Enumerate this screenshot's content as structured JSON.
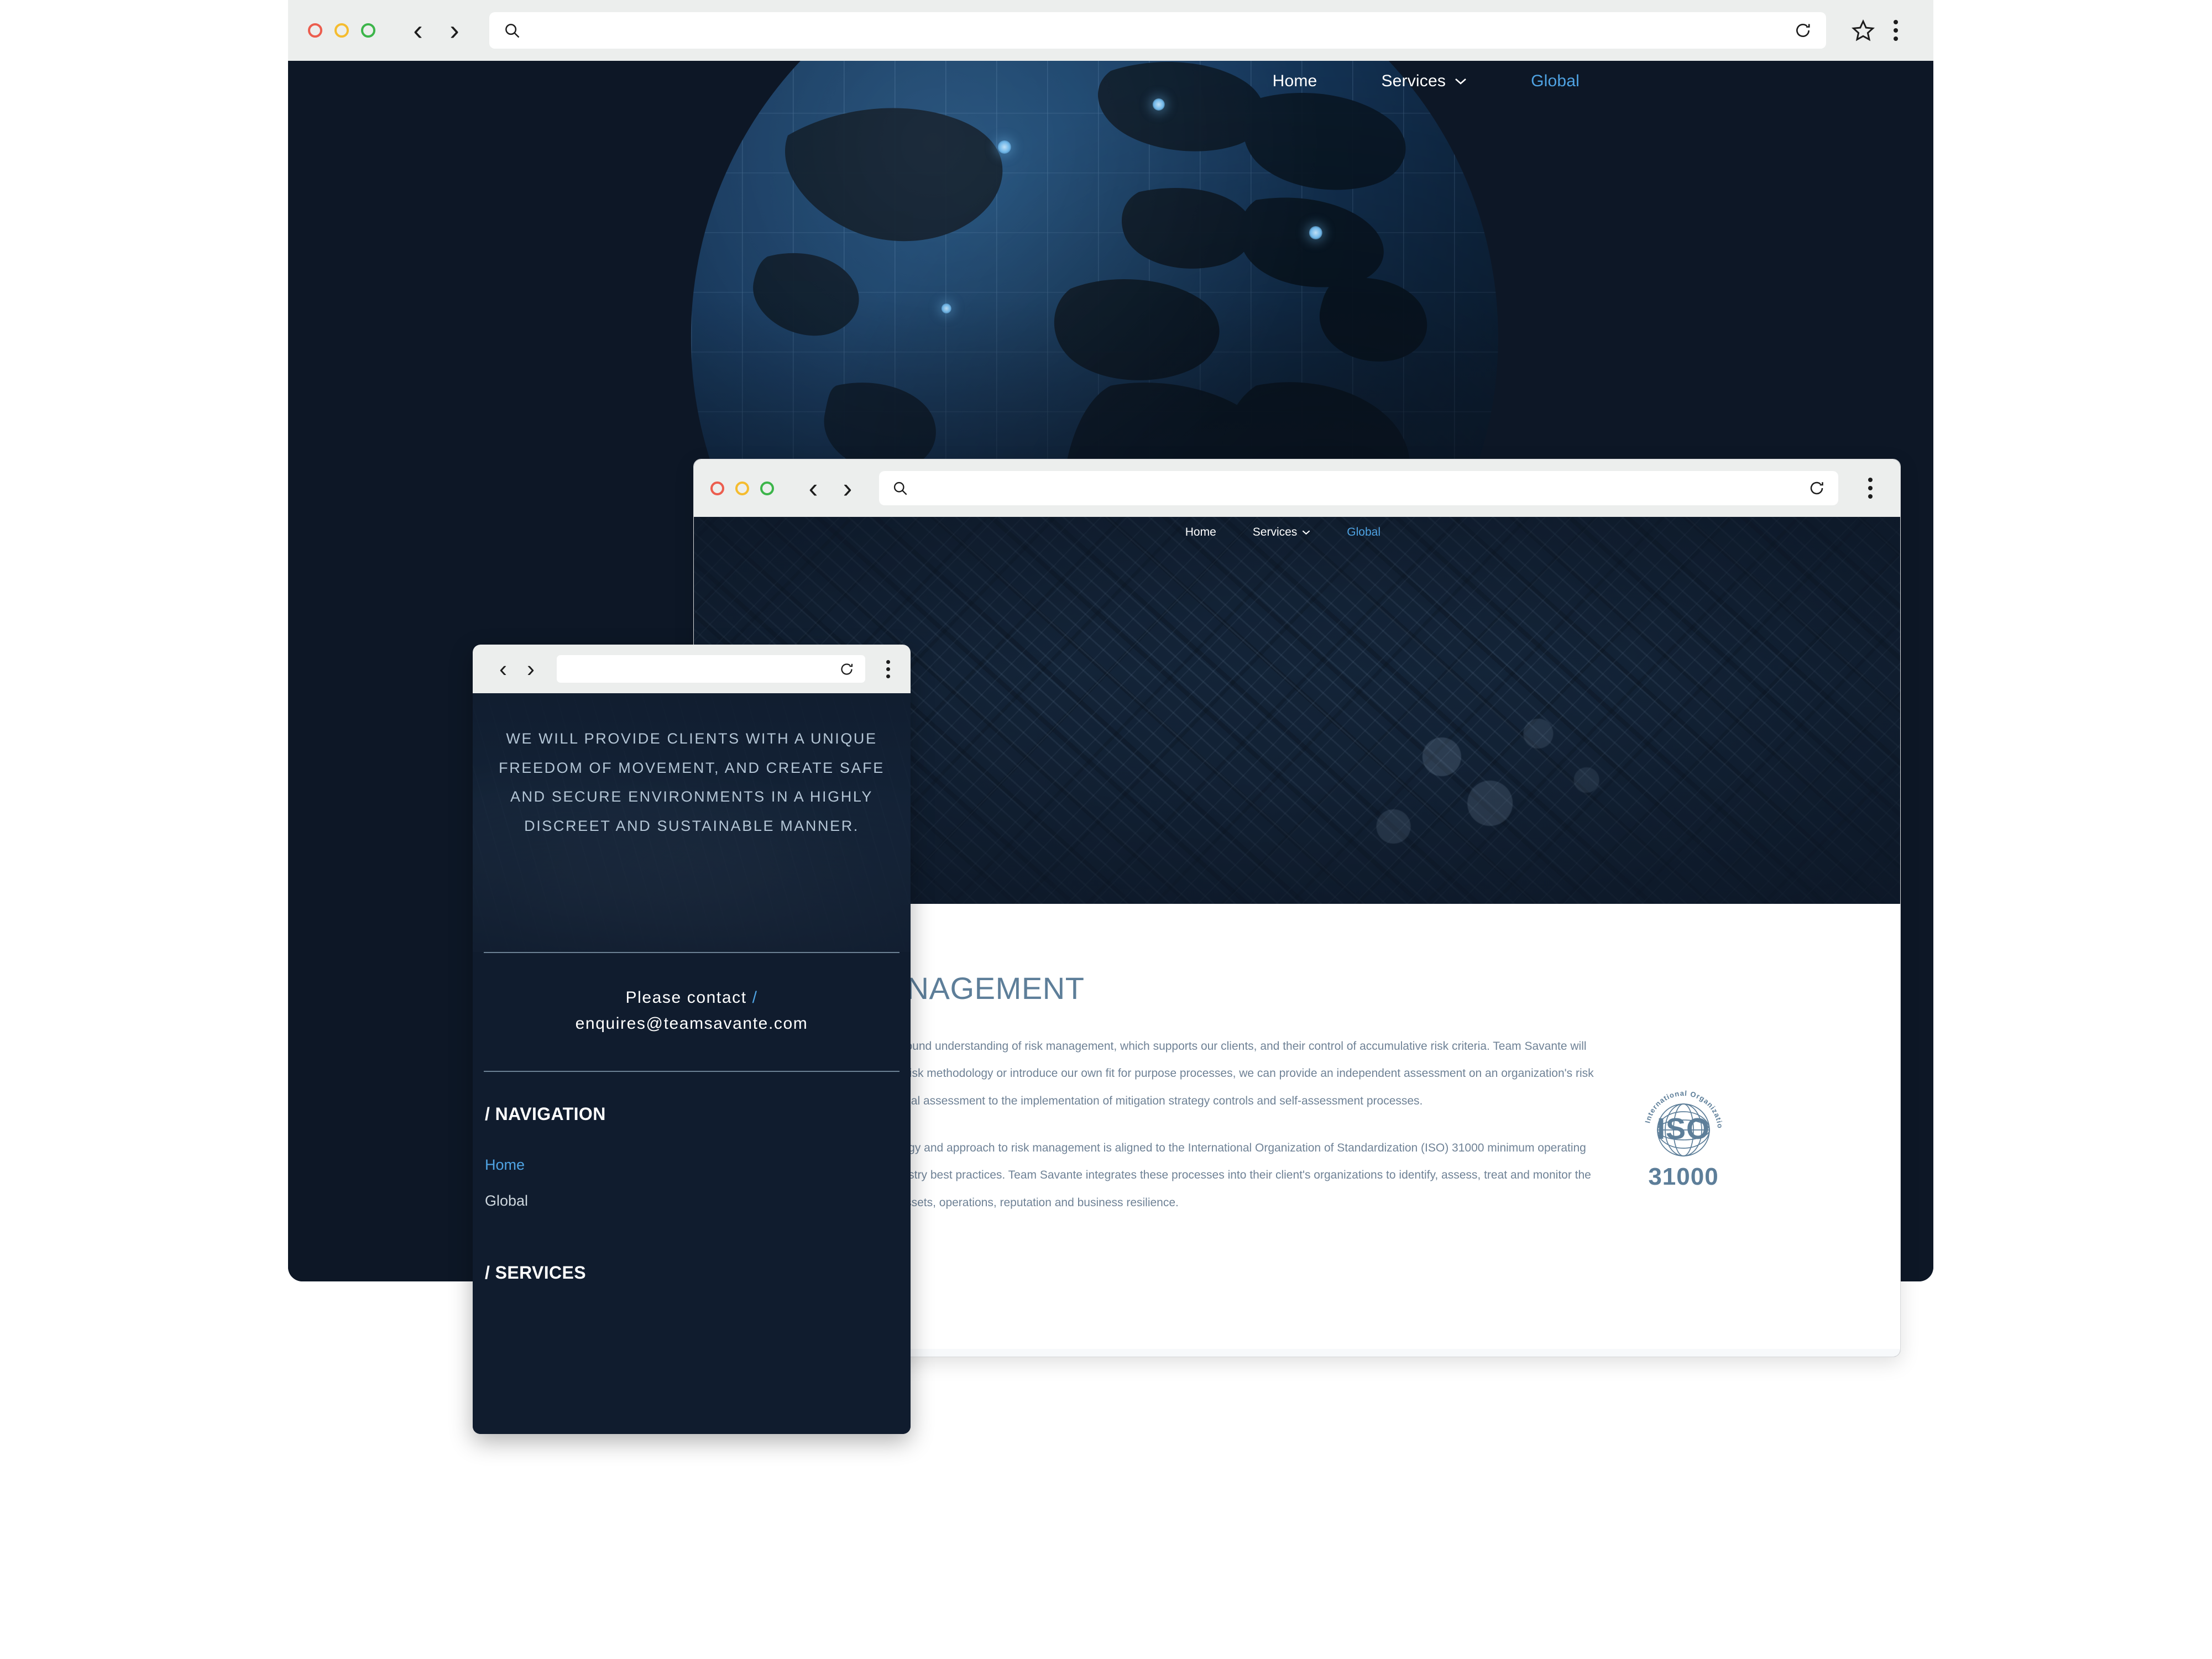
{
  "browser": {
    "desktop": {
      "traffic_lights": [
        "close-red",
        "minimize-yellow",
        "maximize-green"
      ],
      "back_label": "‹",
      "forward_label": "›",
      "search_icon": "search-icon",
      "url_value": "",
      "url_placeholder": "",
      "reload_icon": "reload-icon",
      "bookmark_icon": "star-icon",
      "menu_icon": "kebab-menu-icon"
    },
    "tablet": {
      "traffic_lights": [
        "close-red",
        "minimize-yellow",
        "maximize-green"
      ],
      "back_label": "‹",
      "forward_label": "›",
      "search_icon": "search-icon",
      "url_value": "",
      "reload_icon": "reload-icon",
      "menu_icon": "kebab-menu-icon"
    },
    "mobile": {
      "back_label": "‹",
      "forward_label": "›",
      "url_value": "",
      "reload_icon": "reload-icon",
      "menu_icon": "kebab-menu-icon"
    }
  },
  "site_nav": {
    "home": "Home",
    "services": "Services",
    "services_chevron": "⌄",
    "global": "Global"
  },
  "desktop_page": {
    "hero_graphic": "globe-illustration"
  },
  "tablet_page": {
    "hero_graphic": "industrial-aerial-photo",
    "section": {
      "title": "RISK MANAGEMENT",
      "paragraphs": [
        "Team Savante has a profound understanding of risk management, which supports our clients, and their control of accumulative risk criteria. Team Savante will utilize a client's in-house risk methodology or introduce our own fit for purpose processes, we can provide an independent assessment on an organization's risk management from the initial assessment to the implementation of mitigation strategy controls and self-assessment processes.",
        "Team Savante methodology and approach to risk management is aligned to the International Organization of Standardization (ISO) 31000 minimum operating standards, and other industry best practices. Team Savante integrates these processes into their client's organizations to identify, assess, treat and monitor the risk that affects people, assets, operations, reputation and business resilience."
      ],
      "iso_badge": {
        "mark": "ISO",
        "ring_text": "International Organization for Standardization",
        "number": "31000"
      }
    }
  },
  "mobile_page": {
    "mission_statement": "We will provide clients with a unique freedom of movement, and create safe and secure environments in a highly discreet and sustainable manner.",
    "contact": {
      "label": "Please contact",
      "slash": "/",
      "email": "enquires@teamsavante.com"
    },
    "navigation_section": {
      "heading": "/ NAVIGATION",
      "links": [
        {
          "label": "Home",
          "state": "active"
        },
        {
          "label": "Global",
          "state": "default"
        }
      ]
    },
    "services_section": {
      "heading": "/ SERVICES"
    }
  },
  "colors": {
    "page_background": "#ffffff",
    "window_dark": "#0d1726",
    "mobile_dark": "#101c2e",
    "chrome_gray": "#eceeed",
    "accent_blue": "#4fa3e3",
    "heading_slate": "#5d7e99",
    "body_slate": "#6f8296",
    "mission_text": "#b4c6d6",
    "traffic_red": "#ec5d4e",
    "traffic_yellow": "#f5bc2f",
    "traffic_green": "#3cb54a"
  }
}
